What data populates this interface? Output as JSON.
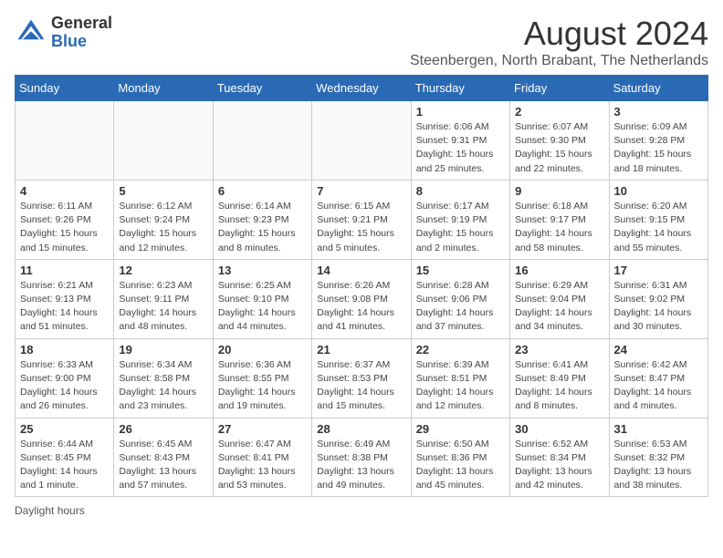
{
  "header": {
    "logo": {
      "general": "General",
      "blue": "Blue"
    },
    "title": "August 2024",
    "subtitle": "Steenbergen, North Brabant, The Netherlands"
  },
  "calendar": {
    "days_of_week": [
      "Sunday",
      "Monday",
      "Tuesday",
      "Wednesday",
      "Thursday",
      "Friday",
      "Saturday"
    ],
    "weeks": [
      [
        {
          "day": "",
          "info": ""
        },
        {
          "day": "",
          "info": ""
        },
        {
          "day": "",
          "info": ""
        },
        {
          "day": "",
          "info": ""
        },
        {
          "day": "1",
          "info": "Sunrise: 6:06 AM\nSunset: 9:31 PM\nDaylight: 15 hours\nand 25 minutes."
        },
        {
          "day": "2",
          "info": "Sunrise: 6:07 AM\nSunset: 9:30 PM\nDaylight: 15 hours\nand 22 minutes."
        },
        {
          "day": "3",
          "info": "Sunrise: 6:09 AM\nSunset: 9:28 PM\nDaylight: 15 hours\nand 18 minutes."
        }
      ],
      [
        {
          "day": "4",
          "info": "Sunrise: 6:11 AM\nSunset: 9:26 PM\nDaylight: 15 hours\nand 15 minutes."
        },
        {
          "day": "5",
          "info": "Sunrise: 6:12 AM\nSunset: 9:24 PM\nDaylight: 15 hours\nand 12 minutes."
        },
        {
          "day": "6",
          "info": "Sunrise: 6:14 AM\nSunset: 9:23 PM\nDaylight: 15 hours\nand 8 minutes."
        },
        {
          "day": "7",
          "info": "Sunrise: 6:15 AM\nSunset: 9:21 PM\nDaylight: 15 hours\nand 5 minutes."
        },
        {
          "day": "8",
          "info": "Sunrise: 6:17 AM\nSunset: 9:19 PM\nDaylight: 15 hours\nand 2 minutes."
        },
        {
          "day": "9",
          "info": "Sunrise: 6:18 AM\nSunset: 9:17 PM\nDaylight: 14 hours\nand 58 minutes."
        },
        {
          "day": "10",
          "info": "Sunrise: 6:20 AM\nSunset: 9:15 PM\nDaylight: 14 hours\nand 55 minutes."
        }
      ],
      [
        {
          "day": "11",
          "info": "Sunrise: 6:21 AM\nSunset: 9:13 PM\nDaylight: 14 hours\nand 51 minutes."
        },
        {
          "day": "12",
          "info": "Sunrise: 6:23 AM\nSunset: 9:11 PM\nDaylight: 14 hours\nand 48 minutes."
        },
        {
          "day": "13",
          "info": "Sunrise: 6:25 AM\nSunset: 9:10 PM\nDaylight: 14 hours\nand 44 minutes."
        },
        {
          "day": "14",
          "info": "Sunrise: 6:26 AM\nSunset: 9:08 PM\nDaylight: 14 hours\nand 41 minutes."
        },
        {
          "day": "15",
          "info": "Sunrise: 6:28 AM\nSunset: 9:06 PM\nDaylight: 14 hours\nand 37 minutes."
        },
        {
          "day": "16",
          "info": "Sunrise: 6:29 AM\nSunset: 9:04 PM\nDaylight: 14 hours\nand 34 minutes."
        },
        {
          "day": "17",
          "info": "Sunrise: 6:31 AM\nSunset: 9:02 PM\nDaylight: 14 hours\nand 30 minutes."
        }
      ],
      [
        {
          "day": "18",
          "info": "Sunrise: 6:33 AM\nSunset: 9:00 PM\nDaylight: 14 hours\nand 26 minutes."
        },
        {
          "day": "19",
          "info": "Sunrise: 6:34 AM\nSunset: 8:58 PM\nDaylight: 14 hours\nand 23 minutes."
        },
        {
          "day": "20",
          "info": "Sunrise: 6:36 AM\nSunset: 8:55 PM\nDaylight: 14 hours\nand 19 minutes."
        },
        {
          "day": "21",
          "info": "Sunrise: 6:37 AM\nSunset: 8:53 PM\nDaylight: 14 hours\nand 15 minutes."
        },
        {
          "day": "22",
          "info": "Sunrise: 6:39 AM\nSunset: 8:51 PM\nDaylight: 14 hours\nand 12 minutes."
        },
        {
          "day": "23",
          "info": "Sunrise: 6:41 AM\nSunset: 8:49 PM\nDaylight: 14 hours\nand 8 minutes."
        },
        {
          "day": "24",
          "info": "Sunrise: 6:42 AM\nSunset: 8:47 PM\nDaylight: 14 hours\nand 4 minutes."
        }
      ],
      [
        {
          "day": "25",
          "info": "Sunrise: 6:44 AM\nSunset: 8:45 PM\nDaylight: 14 hours\nand 1 minute."
        },
        {
          "day": "26",
          "info": "Sunrise: 6:45 AM\nSunset: 8:43 PM\nDaylight: 13 hours\nand 57 minutes."
        },
        {
          "day": "27",
          "info": "Sunrise: 6:47 AM\nSunset: 8:41 PM\nDaylight: 13 hours\nand 53 minutes."
        },
        {
          "day": "28",
          "info": "Sunrise: 6:49 AM\nSunset: 8:38 PM\nDaylight: 13 hours\nand 49 minutes."
        },
        {
          "day": "29",
          "info": "Sunrise: 6:50 AM\nSunset: 8:36 PM\nDaylight: 13 hours\nand 45 minutes."
        },
        {
          "day": "30",
          "info": "Sunrise: 6:52 AM\nSunset: 8:34 PM\nDaylight: 13 hours\nand 42 minutes."
        },
        {
          "day": "31",
          "info": "Sunrise: 6:53 AM\nSunset: 8:32 PM\nDaylight: 13 hours\nand 38 minutes."
        }
      ]
    ]
  },
  "footer": {
    "note": "Daylight hours"
  }
}
